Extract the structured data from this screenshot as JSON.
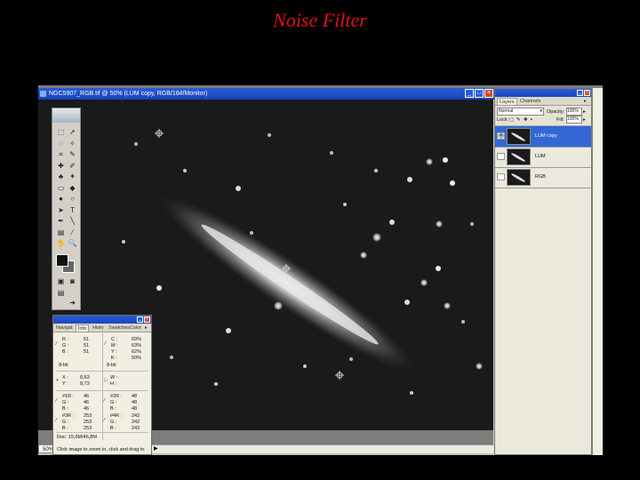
{
  "slide": {
    "title": "Noise Filter"
  },
  "document_window": {
    "title": "NGC5907_RGB.tif @ 50% (LUM copy, RGB/16#/Monitor)",
    "zoom": "50%",
    "controls": {
      "minimize": "_",
      "maximize": "□",
      "close": "×"
    }
  },
  "toolbox": {
    "tools": [
      "marquee-icon",
      "move-icon",
      "lasso-icon",
      "magic-wand-icon",
      "crop-icon",
      "slice-icon",
      "healing-brush-icon",
      "brush-icon",
      "clone-stamp-icon",
      "history-brush-icon",
      "eraser-icon",
      "bucket-icon",
      "blur-icon",
      "dodge-icon",
      "path-select-icon",
      "type-icon",
      "pen-icon",
      "line-icon",
      "notes-icon",
      "eyedropper-icon",
      "hand-icon",
      "zoom-icon"
    ],
    "glyphs": [
      "⬚",
      "➚",
      "◌",
      "✧",
      "⌗",
      "✎",
      "✚",
      "✐",
      "♣",
      "✦",
      "▭",
      "◆",
      "●",
      "○",
      "➤",
      "T",
      "✒",
      "╲",
      "▤",
      "⁄",
      "✋",
      "🔍"
    ],
    "colors": {
      "foreground": "#111111",
      "background": "#666666"
    }
  },
  "info_panel": {
    "tabs": [
      "Navigat",
      "Info",
      "Histo",
      "Swatches",
      "Color"
    ],
    "active_tab": "Info",
    "rgb": {
      "R_label": "R :",
      "R": "51",
      "G_label": "G :",
      "G": "51",
      "B_label": "B :",
      "B": "51"
    },
    "cmyk": {
      "C_label": "C :",
      "C": "69%",
      "M_label": "M :",
      "M": "63%",
      "Y_label": "Y :",
      "Y": "62%",
      "K_label": "K :",
      "K": "50%"
    },
    "bit_left": "8-bit",
    "bit_right": "8-bit",
    "xy": {
      "X_label": "X :",
      "X": "8,63",
      "Y_label": "Y :",
      "Y": "8,73"
    },
    "wh": {
      "W_label": "W :",
      "H_label": "H :"
    },
    "samplers": [
      {
        "R_label": "#1R :",
        "R": "46",
        "G_label": "G :",
        "G": "46",
        "B_label": "B :",
        "B": "46"
      },
      {
        "R_label": "#2R :",
        "R": "48",
        "G_label": "G :",
        "G": "48",
        "B_label": "B :",
        "B": "48"
      },
      {
        "R_label": "#3R :",
        "R": "253",
        "G_label": "G :",
        "G": "253",
        "B_label": "B :",
        "B": "253"
      },
      {
        "R_label": "#4R :",
        "R": "242",
        "G_label": "G :",
        "G": "242",
        "B_label": "B :",
        "B": "242"
      }
    ],
    "doc": "Doc: 15,6M/46,8M",
    "hint": "Click image to zoom in, click and drag to"
  },
  "layers_panel": {
    "tabs": [
      "Layers",
      "Channels"
    ],
    "active_tab": "Layers",
    "blend_mode": "Normal",
    "opacity_label": "Opacity:",
    "opacity": "100%",
    "lock_label": "Lock:",
    "fill_label": "Fill:",
    "fill": "100%",
    "layers": [
      {
        "name": "LUM copy",
        "active": true,
        "visible": true
      },
      {
        "name": "LUM",
        "active": false,
        "visible": false
      },
      {
        "name": "RGB",
        "active": false,
        "visible": false
      }
    ],
    "eye_glyph": "👁"
  }
}
